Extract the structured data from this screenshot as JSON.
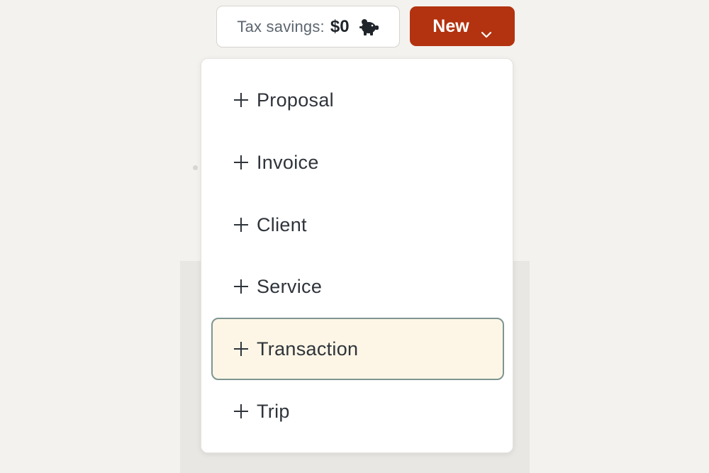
{
  "header": {
    "tax_savings_label": "Tax savings:",
    "tax_savings_value": "$0",
    "new_button_label": "New",
    "icons": {
      "piggy": "piggy-bank-icon",
      "chevron": "chevron-down-icon",
      "plus": "plus-icon"
    }
  },
  "menu": {
    "items": [
      {
        "label": "Proposal"
      },
      {
        "label": "Invoice"
      },
      {
        "label": "Client"
      },
      {
        "label": "Service"
      },
      {
        "label": "Transaction",
        "highlighted": true
      },
      {
        "label": "Trip"
      }
    ]
  },
  "colors": {
    "accent": "#b3320f",
    "highlight_bg": "#fdf6e6",
    "highlight_border": "#7f9591",
    "page_bg": "#f4f2ef"
  }
}
